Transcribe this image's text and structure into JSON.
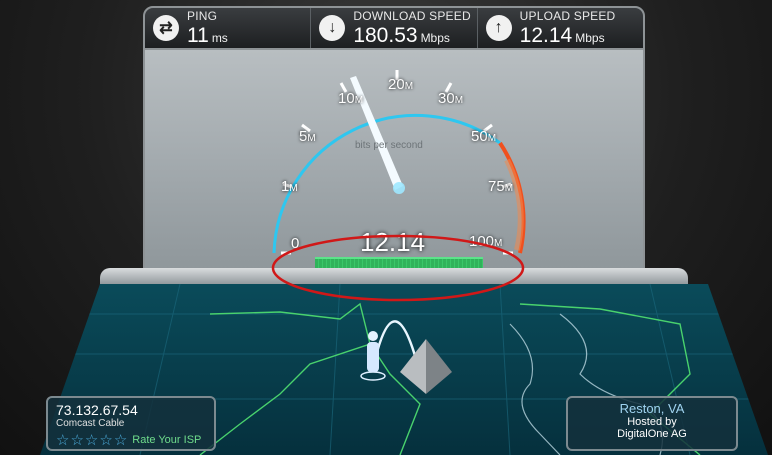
{
  "stats": {
    "ping": {
      "label": "PING",
      "value": "11",
      "unit": "ms",
      "icon": "swap-arrows-icon"
    },
    "download": {
      "label": "DOWNLOAD SPEED",
      "value": "180.53",
      "unit": "Mbps",
      "icon": "arrow-down-icon"
    },
    "upload": {
      "label": "UPLOAD SPEED",
      "value": "12.14",
      "unit": "Mbps",
      "icon": "arrow-up-icon"
    }
  },
  "gauge": {
    "unit_label": "bits per second",
    "readout": "12.14",
    "ticks": [
      {
        "num": "0",
        "suffix": ""
      },
      {
        "num": "1",
        "suffix": "M"
      },
      {
        "num": "5",
        "suffix": "M"
      },
      {
        "num": "10",
        "suffix": "M"
      },
      {
        "num": "20",
        "suffix": "M"
      },
      {
        "num": "30",
        "suffix": "M"
      },
      {
        "num": "50",
        "suffix": "M"
      },
      {
        "num": "75",
        "suffix": "M"
      },
      {
        "num": "100",
        "suffix": "M"
      }
    ]
  },
  "client": {
    "ip": "73.132.67.54",
    "isp": "Comcast Cable",
    "rate_label": "Rate Your ISP",
    "stars": 5
  },
  "server": {
    "city": "Reston, VA",
    "hosted_by": "Hosted by",
    "host": "DigitalOne AG"
  },
  "colors": {
    "gauge_arc": "#2ec7f0",
    "gauge_high": "#f0501e",
    "result_bar": "#39c768",
    "highlight": "#d01818"
  }
}
